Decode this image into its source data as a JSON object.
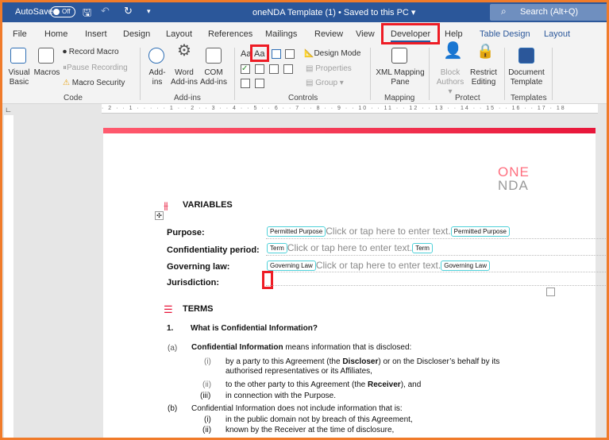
{
  "titlebar": {
    "autosave": "AutoSave",
    "toggle": "Off",
    "title": "oneNDA Template (1) • Saved to this PC ▾",
    "search": "Search (Alt+Q)"
  },
  "tabs": [
    "File",
    "Home",
    "Insert",
    "Design",
    "Layout",
    "References",
    "Mailings",
    "Review",
    "View",
    "Developer",
    "Help",
    "Table Design",
    "Layout"
  ],
  "ribbon": {
    "code": {
      "visual_basic": "Visual Basic",
      "macros": "Macros",
      "record": "Record Macro",
      "pause": "Pause Recording",
      "security": "Macro Security",
      "group": "Code"
    },
    "addins": {
      "addins": "Add-ins",
      "word": "Word Add-ins",
      "com": "COM Add-ins",
      "group": "Add-ins"
    },
    "controls": {
      "design_mode": "Design Mode",
      "properties": "Properties",
      "group_btn": "Group ▾",
      "group": "Controls",
      "aa1": "Aa",
      "aa2": "Aa"
    },
    "mapping": {
      "xml": "XML Mapping Pane",
      "group": "Mapping"
    },
    "protect": {
      "block": "Block Authors ▾",
      "restrict": "Restrict Editing",
      "group": "Protect"
    },
    "templates": {
      "doc": "Document Template",
      "group": "Templates"
    }
  },
  "ruler": "· 2 · · 1 · · · · · 1 · · 2 · · 3 · · 4 · · 5 · · 6 · · 7 · · 8 · · 9 · · 10 · · 11 · · 12 · · 13 · · 14 · · 15 · · 16 · · 17 · 18",
  "doc": {
    "logo_top": "ONE",
    "logo_bottom": "NDA",
    "variables_heading": "VARIABLES",
    "rows": [
      {
        "label": "Purpose:",
        "tag": "Permitted Purpose"
      },
      {
        "label": "Confidentiality period:",
        "tag": "Term"
      },
      {
        "label": "Governing law:",
        "tag": "Governing Law"
      },
      {
        "label": "Jurisdiction:"
      }
    ],
    "placeholder": "Click or tap here to enter text.",
    "terms_heading": "TERMS",
    "s1_num": "1.",
    "s1_title": "What is Confidential Information?",
    "a_num": "(a)",
    "a_bold": "Confidential Information",
    "a_rest": " means information that is disclosed:",
    "a_i_num": "(i)",
    "a_i_1": "by a party to this Agreement (the ",
    "a_i_b": "Discloser",
    "a_i_2": ") or on the Discloser’s behalf by its",
    "a_i_3": "authorised representatives or its Affiliates,",
    "a_ii_num": "(ii)",
    "a_ii_1": "to the other party to this Agreement (the ",
    "a_ii_b": "Receiver",
    "a_ii_2": "), and",
    "a_iii_num": "(iii)",
    "a_iii": "in connection with the Purpose.",
    "b_num": "(b)",
    "b_text": "Confidential Information does not include information that is:",
    "b_i_num": "(i)",
    "b_i": "in the public domain not by breach of this Agreement,",
    "b_ii_num": "(ii)",
    "b_ii": "known by the Receiver at the time of disclosure,"
  },
  "colors": {
    "titlebar": "#2b579a",
    "highlight": "#ee1c25",
    "frame": "#f07b2a",
    "control_border": "#4fd1d9"
  }
}
